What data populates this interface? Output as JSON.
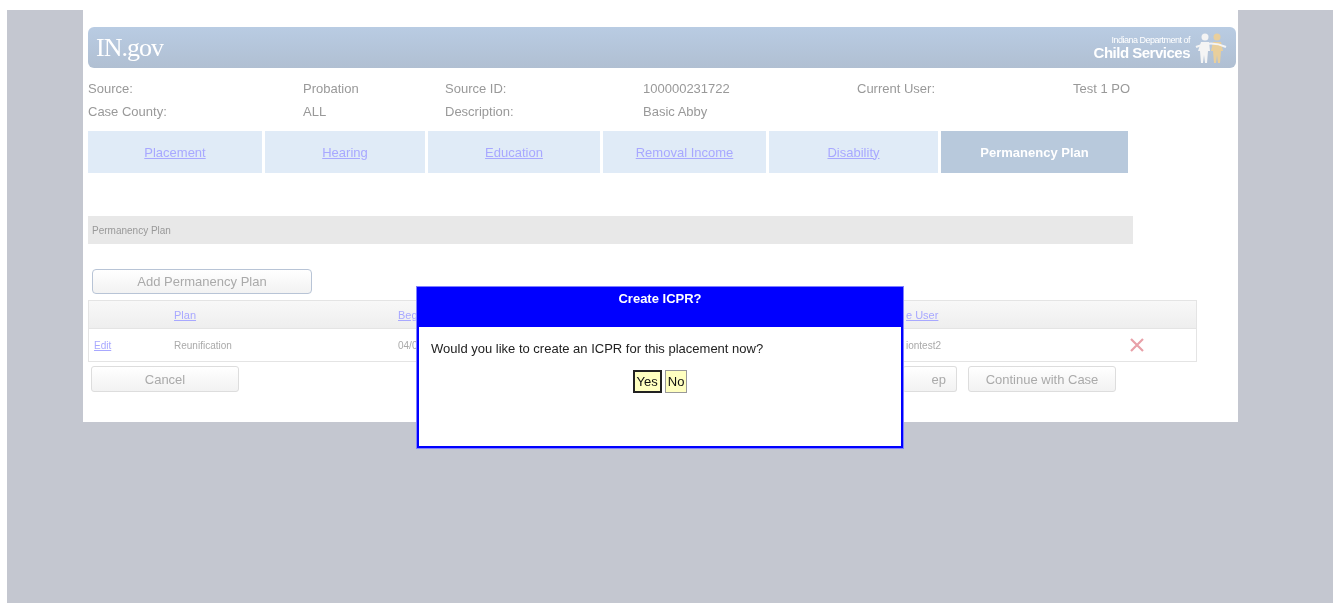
{
  "header": {
    "logo": "IN.gov",
    "agency_line_1": "Indiana Department of",
    "agency_line_2": "Child Services"
  },
  "case_info": [
    {
      "label": "Source:",
      "value": "Probation"
    },
    {
      "label": "Source ID:",
      "value": "100000231722"
    },
    {
      "label": "Current User:",
      "value": "Test 1 PO"
    },
    {
      "label": "Case County:",
      "value": "ALL"
    },
    {
      "label": "Description:",
      "value": "Basic Abby"
    }
  ],
  "tabs": [
    {
      "label": "Placement",
      "selected": false
    },
    {
      "label": "Hearing",
      "selected": false
    },
    {
      "label": "Education",
      "selected": false
    },
    {
      "label": "Removal Income",
      "selected": false
    },
    {
      "label": "Disability",
      "selected": false
    },
    {
      "label": "Permanency Plan",
      "selected": true
    }
  ],
  "section_title": "Permanency Plan",
  "add_button": "Add Permanency Plan",
  "table": {
    "columns": [
      "Plan",
      "Beg",
      "e User"
    ],
    "rows": [
      {
        "edit": "Edit",
        "plan": "Reunification",
        "column_2": "04/0",
        "column_3": "iontest2"
      }
    ]
  },
  "buttons": {
    "cancel": "Cancel",
    "partial": "ep",
    "continue": "Continue with Case"
  },
  "dialog": {
    "title": "Create ICPR?",
    "message": "Would you like to create an ICPR for this placement now?",
    "buttons": [
      {
        "label": "Yes",
        "selected": true
      },
      {
        "label": "No",
        "selected": false
      }
    ]
  }
}
